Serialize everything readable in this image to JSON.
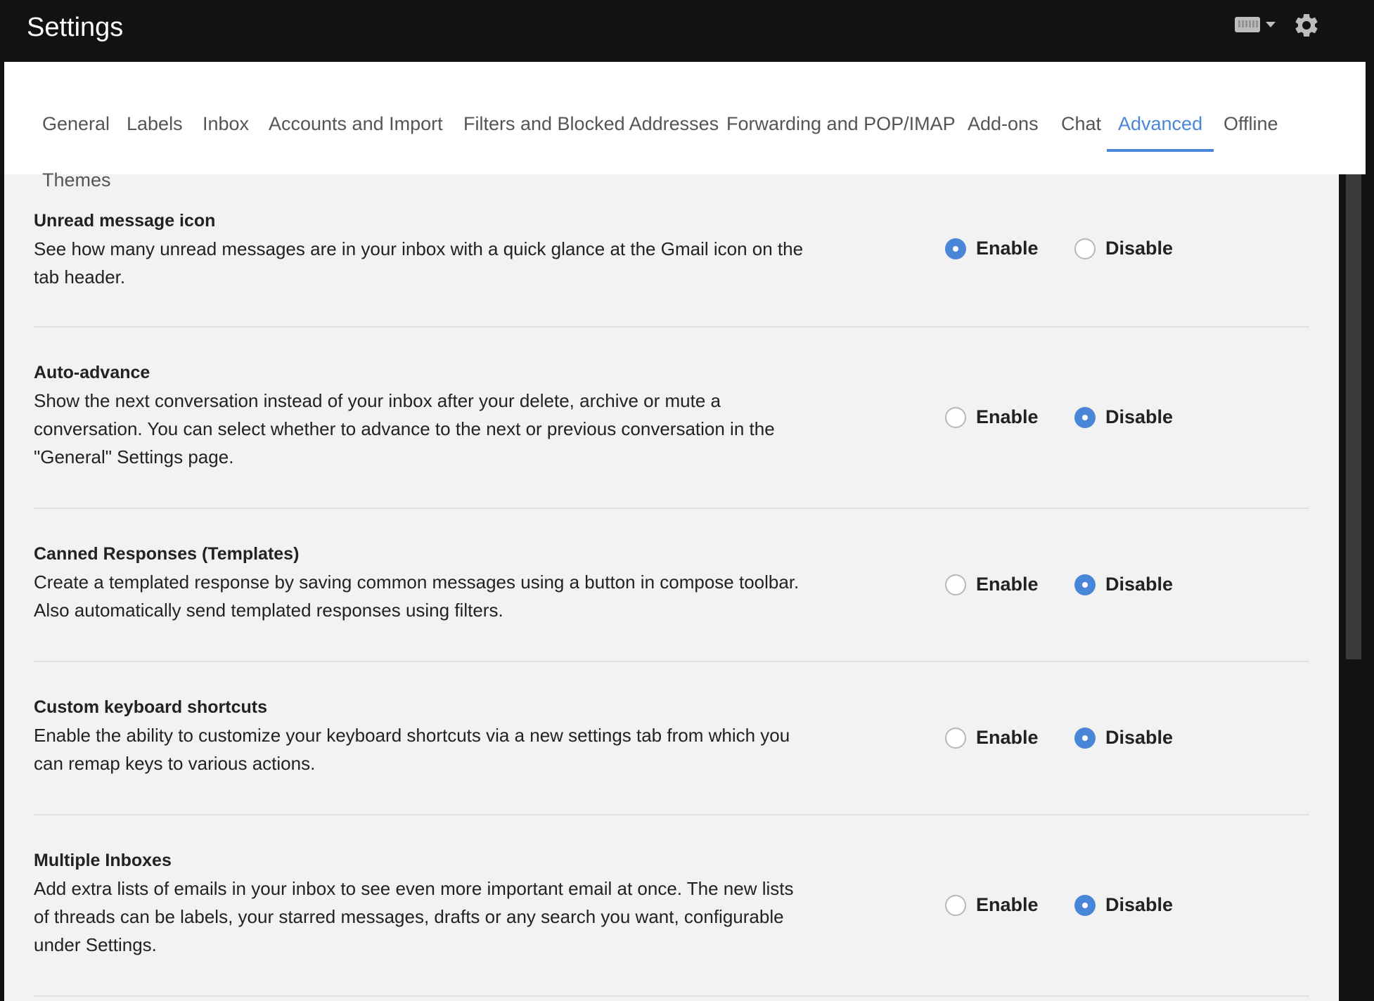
{
  "header": {
    "title": "Settings",
    "keyboard_icon": "keyboard-icon",
    "settings_icon": "gear-icon"
  },
  "tabs": [
    {
      "label": "General",
      "active": false
    },
    {
      "label": "Labels",
      "active": false
    },
    {
      "label": "Inbox",
      "active": false
    },
    {
      "label": "Accounts and Import",
      "active": false
    },
    {
      "label": "Filters and Blocked Addresses",
      "active": false
    },
    {
      "label": "Forwarding and POP/IMAP",
      "active": false
    },
    {
      "label": "Add-ons",
      "active": false
    },
    {
      "label": "Chat",
      "active": false
    },
    {
      "label": "Advanced",
      "active": true
    },
    {
      "label": "Offline",
      "active": false
    },
    {
      "label": "Themes",
      "active": false
    }
  ],
  "settings": [
    {
      "title": "Unread message icon",
      "description": "See how many unread messages are in your inbox with a quick glance at the Gmail icon on the tab header.",
      "enable_label": "Enable",
      "disable_label": "Disable",
      "selected": "enable"
    },
    {
      "title": "Auto-advance",
      "description": "Show the next conversation instead of your inbox after your delete, archive or mute a conversation. You can select whether to advance to the next or previous conversation in the \"General\" Settings page.",
      "enable_label": "Enable",
      "disable_label": "Disable",
      "selected": "disable"
    },
    {
      "title": "Canned Responses (Templates)",
      "description": "Create a templated response by saving common messages using a button in compose toolbar. Also automatically send templated responses using filters.",
      "enable_label": "Enable",
      "disable_label": "Disable",
      "selected": "disable"
    },
    {
      "title": "Custom keyboard shortcuts",
      "description": "Enable the ability to customize your keyboard shortcuts via a new settings tab from which you can remap keys to various actions.",
      "enable_label": "Enable",
      "disable_label": "Disable",
      "selected": "disable"
    },
    {
      "title": "Multiple Inboxes",
      "description": "Add extra lists of emails in your inbox to see even more important email at once. The new lists of threads can be labels, your starred messages, drafts or any search you want, configurable under Settings.",
      "enable_label": "Enable",
      "disable_label": "Disable",
      "selected": "disable"
    }
  ],
  "colors": {
    "accent": "#4a86d8",
    "topbar": "#121212",
    "content_bg": "#f2f2f2"
  }
}
